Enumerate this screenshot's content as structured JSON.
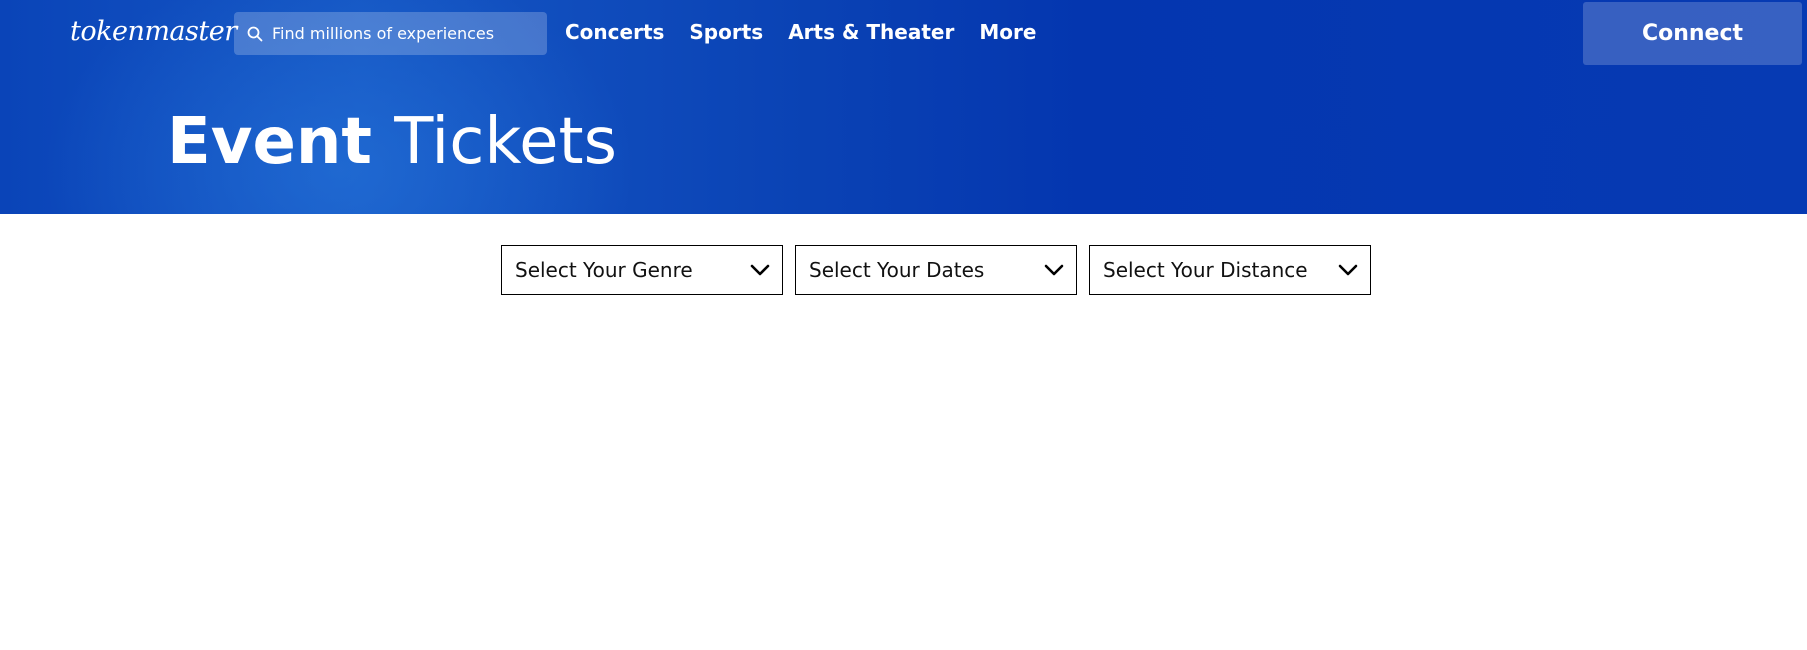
{
  "header": {
    "logo_text": "tokenmaster",
    "search": {
      "placeholder": "Find millions of experiences"
    },
    "nav": [
      {
        "label": "Concerts"
      },
      {
        "label": "Sports"
      },
      {
        "label": "Arts & Theater"
      },
      {
        "label": "More"
      }
    ],
    "connect_label": "Connect"
  },
  "hero": {
    "title_bold": "Event",
    "title_light": "Tickets"
  },
  "filters": [
    {
      "label": "Select Your Genre",
      "icon": "chevron-down-icon"
    },
    {
      "label": "Select Your Dates",
      "icon": "chevron-down-icon"
    },
    {
      "label": "Select Your Distance",
      "icon": "chevron-down-icon"
    }
  ],
  "colors": {
    "brand_blue": "#063ab3",
    "hero_highlight": "#1556c4",
    "text_on_brand": "#ffffff"
  }
}
